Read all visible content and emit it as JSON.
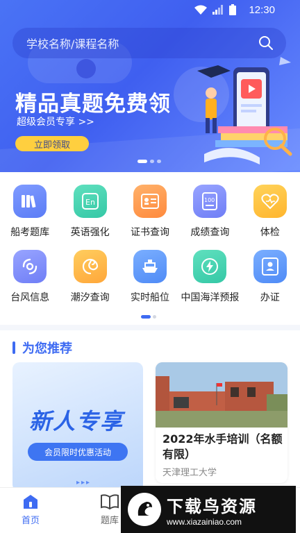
{
  "statusbar": {
    "time": "12:30"
  },
  "search": {
    "placeholder": "学校名称/课程名称"
  },
  "banner": {
    "headline": "精品真题免费领",
    "subline": "超级会员专享 >>",
    "button": "立即领取"
  },
  "grid": {
    "row1": [
      {
        "label": "船考题库",
        "icon": "book-stack-icon",
        "color": "#5b7cf6"
      },
      {
        "label": "英语强化",
        "icon": "english-icon",
        "color": "#35c8a6"
      },
      {
        "label": "证书查询",
        "icon": "certificate-icon",
        "color": "#ff8a3d"
      },
      {
        "label": "成绩查询",
        "icon": "score-icon",
        "color": "#6f7ef6"
      },
      {
        "label": "体检",
        "icon": "heart-icon",
        "color": "#ffb52e"
      }
    ],
    "row2": [
      {
        "label": "台风信息",
        "icon": "typhoon-icon",
        "color": "#6f7ef6"
      },
      {
        "label": "潮汐查询",
        "icon": "tide-icon",
        "color": "#ffa73a"
      },
      {
        "label": "实时船位",
        "icon": "ship-icon",
        "color": "#4f8bf6"
      },
      {
        "label": "中国海洋预报",
        "icon": "lightning-icon",
        "color": "#35c8a6"
      },
      {
        "label": "办证",
        "icon": "id-card-icon",
        "color": "#4f8bf6"
      }
    ]
  },
  "recommend": {
    "title": "为您推荐",
    "card1": {
      "big": "新人专享",
      "pill": "会员限时优惠活动"
    },
    "card2": {
      "title": "2022年水手培训（名额有限）",
      "school": "天津理工大学"
    }
  },
  "nav": {
    "home": "首页",
    "bank": "题库"
  },
  "watermark": {
    "title": "下载鸟资源",
    "url": "www.xiazainiao.com"
  }
}
